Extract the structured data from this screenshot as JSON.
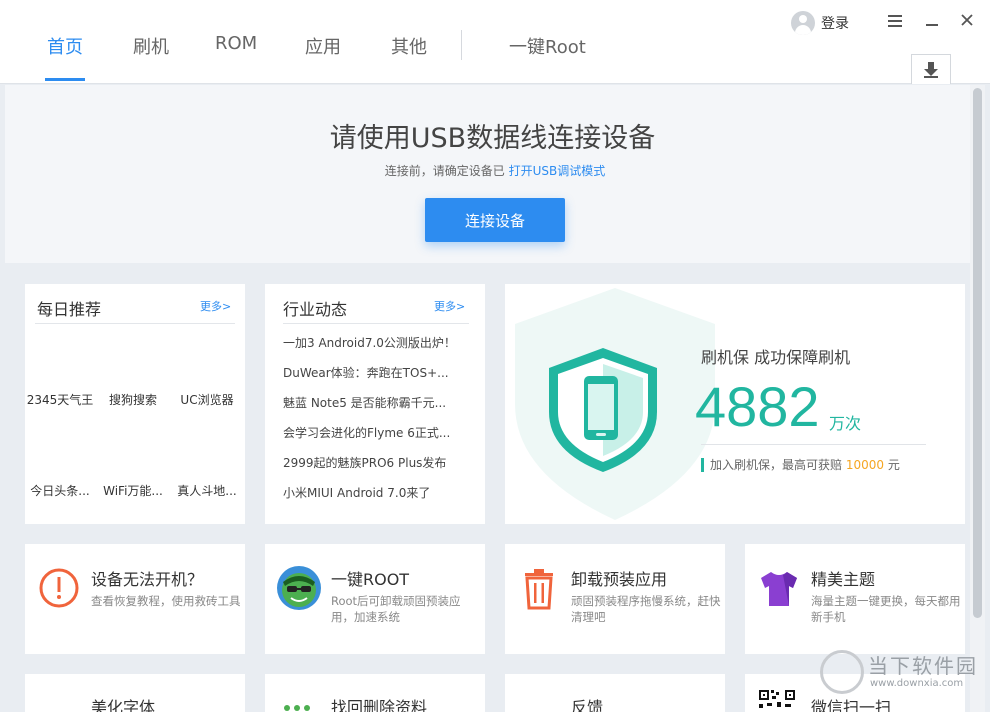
{
  "header": {
    "tabs": [
      {
        "label": "首页",
        "active": true
      },
      {
        "label": "刷机"
      },
      {
        "label": "ROM"
      },
      {
        "label": "应用"
      },
      {
        "label": "其他"
      },
      {
        "label": "一键Root"
      }
    ],
    "login_label": "登录",
    "menu_icon": "hamburger-icon",
    "minimize_icon": "minimize-icon",
    "close_icon": "close-icon",
    "download_icon": "download-icon"
  },
  "connect": {
    "title": "请使用USB数据线连接设备",
    "subtitle_prefix": "连接前，请确定设备已",
    "subtitle_link": "打开USB调试模式",
    "button_label": "连接设备"
  },
  "daily": {
    "title": "每日推荐",
    "more": "更多>",
    "items": [
      "2345天气王",
      "搜狗搜索",
      "UC浏览器",
      "今日头条...",
      "WiFi万能...",
      "真人斗地..."
    ]
  },
  "news": {
    "title": "行业动态",
    "more": "更多>",
    "items": [
      "一加3 Android7.0公测版出炉！",
      "DuWear体验：奔跑在TOS+...",
      "魅蓝 Note5 是否能称霸千元...",
      "会学习会进化的Flyme 6正式...",
      "2999起的魅族PRO6 Plus发布",
      "小米MIUI Android 7.0来了"
    ]
  },
  "protect": {
    "heading": "刷机保  成功保障刷机",
    "count": "4882",
    "unit": "万次",
    "note_prefix": "加入刷机保，最高可获赔 ",
    "note_amount": "10000",
    "note_suffix": " 元",
    "accent_color": "#21b6a0"
  },
  "features": [
    {
      "title": "设备无法开机？",
      "desc": "查看恢复教程，使用救砖工具",
      "icon": "exclamation-icon"
    },
    {
      "title": "一键ROOT",
      "desc": "Root后可卸载顽固预装应用，加速系统",
      "icon": "root-mascot-icon"
    },
    {
      "title": "卸载预装应用",
      "desc": "顽固预装程序拖慢系统，赶快清理吧",
      "icon": "trash-icon"
    },
    {
      "title": "精美主题",
      "desc": "海量主题一键更换，每天都用新手机",
      "icon": "tshirt-icon"
    }
  ],
  "peek_row": [
    "美化字体",
    "找回删除资料",
    "反馈",
    "微信扫一扫"
  ],
  "watermark": {
    "text": "当下软件园",
    "url": "www.downxia.com"
  },
  "colors": {
    "accent": "#2d8cf0",
    "teal": "#21b6a0",
    "orange": "#f5a623"
  }
}
